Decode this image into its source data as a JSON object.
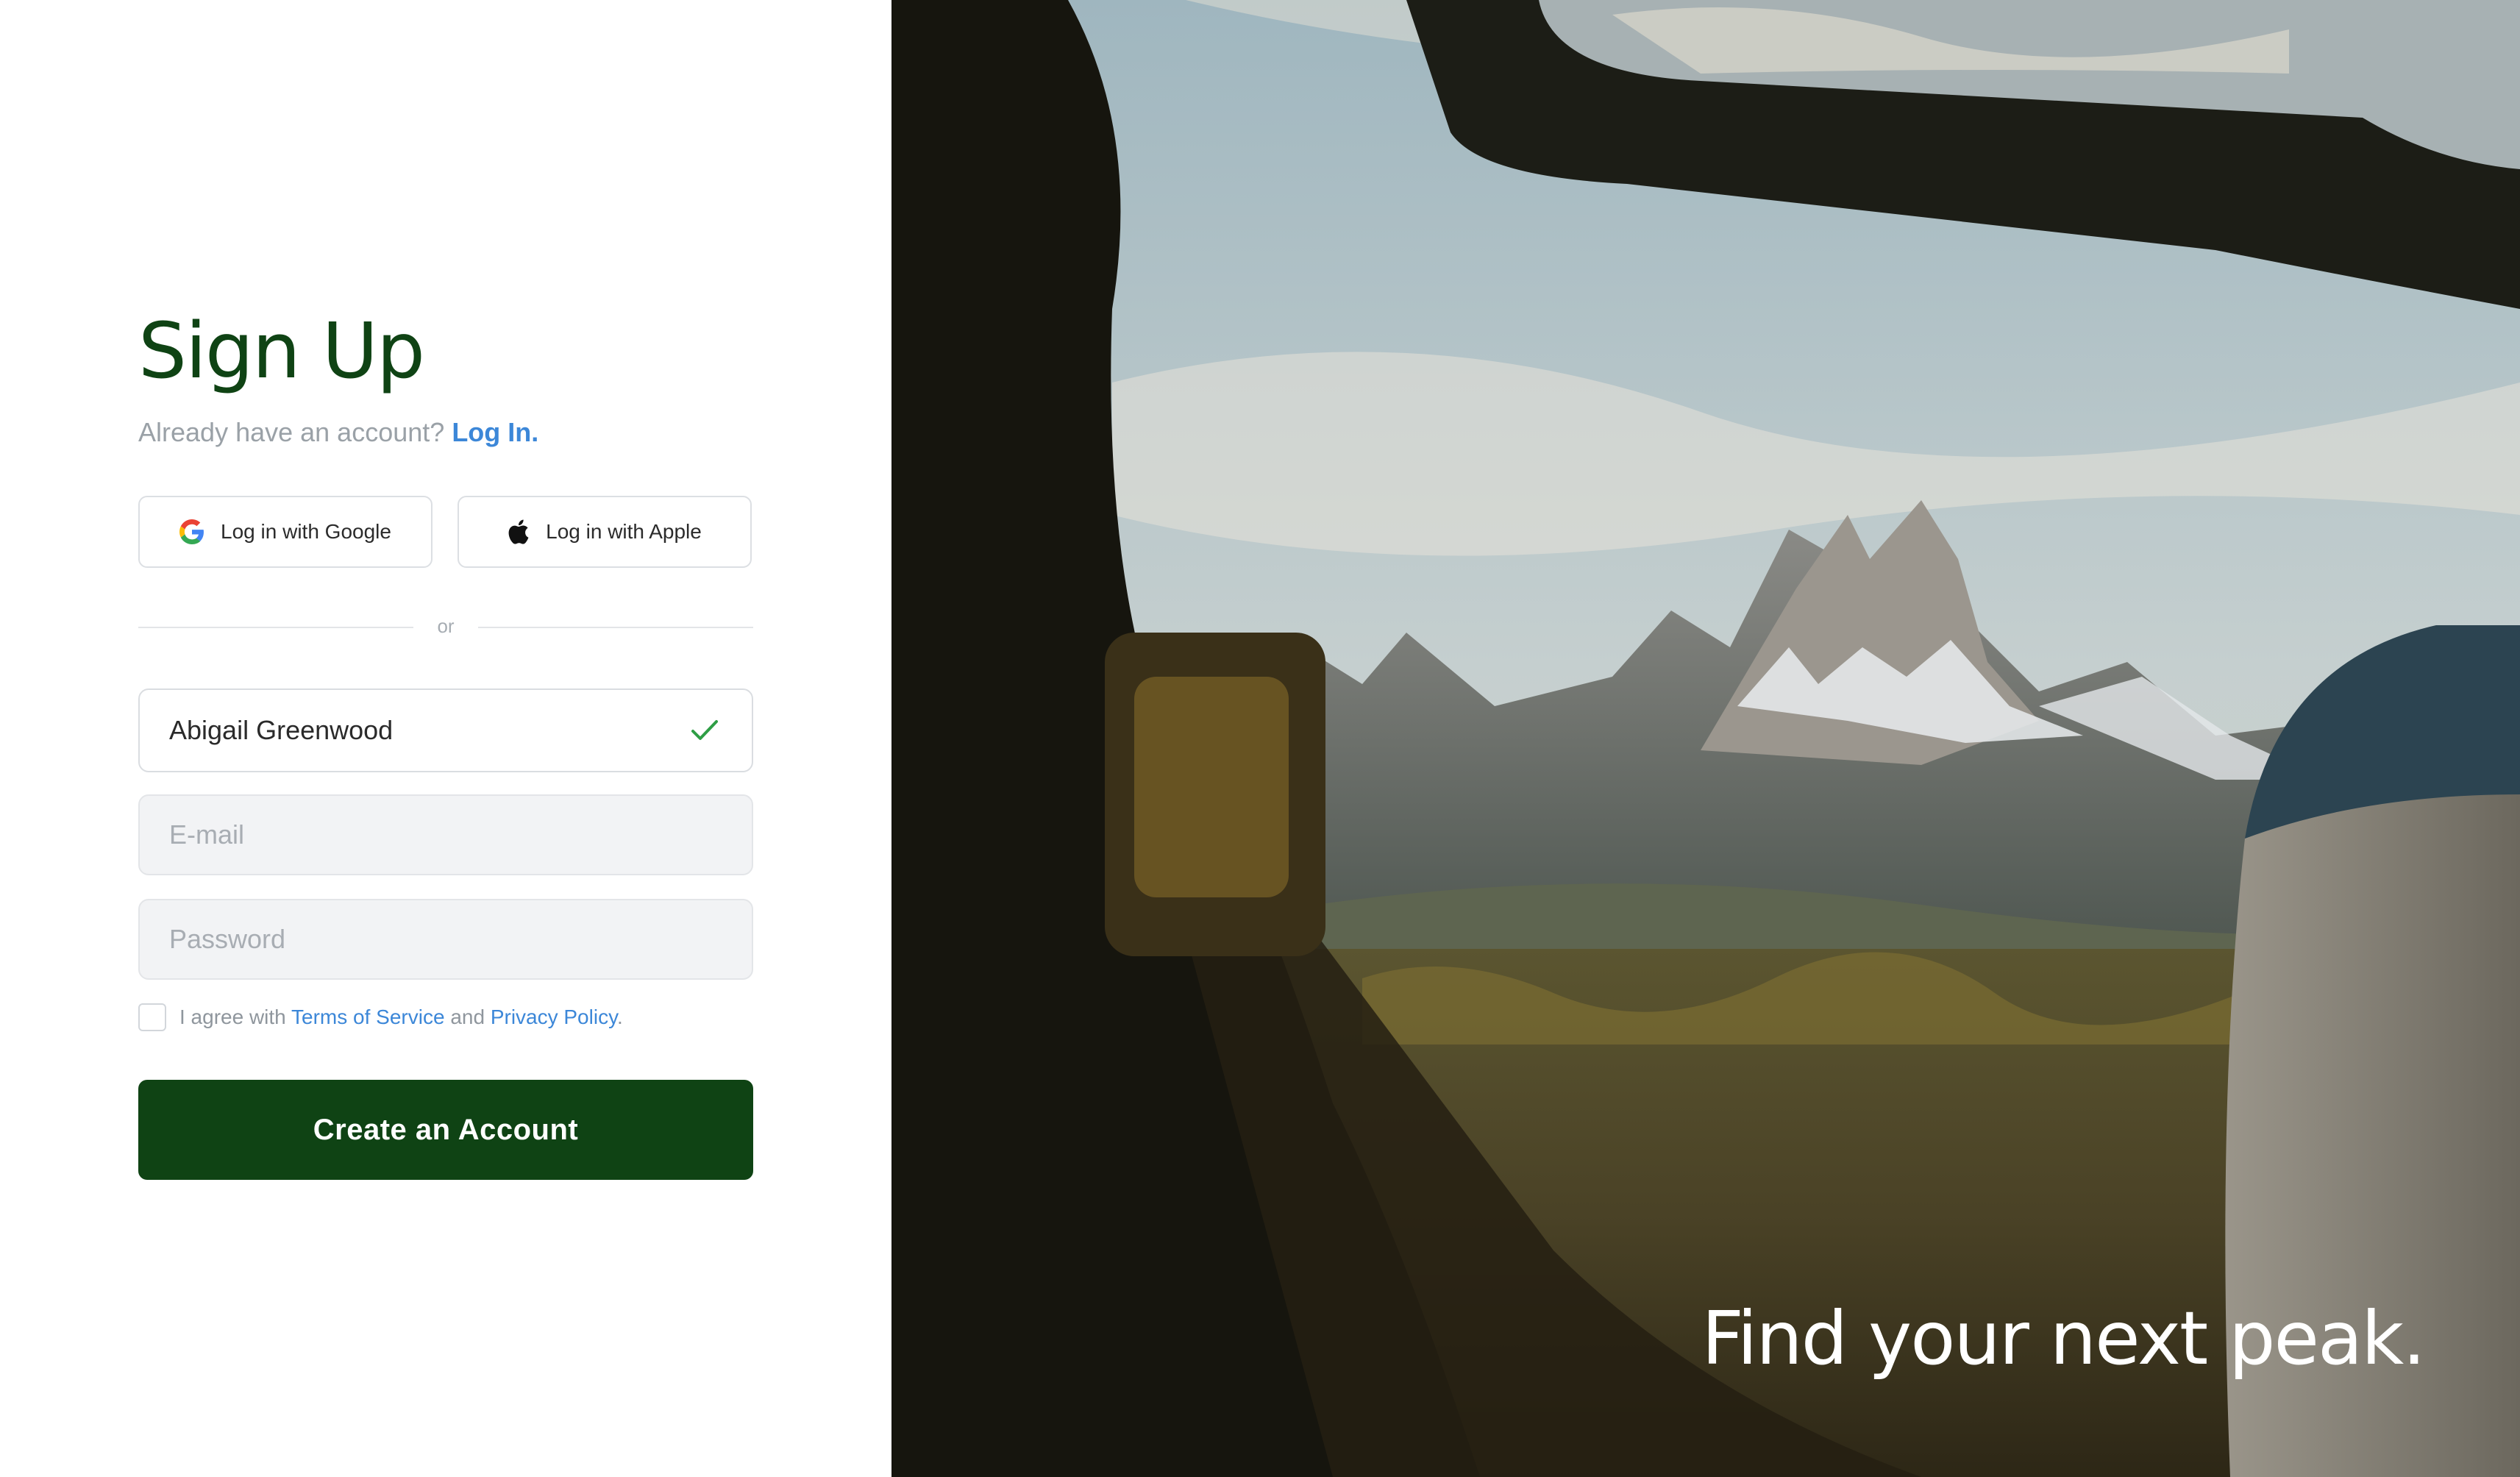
{
  "signup": {
    "title": "Sign Up",
    "have_account": "Already have an account?",
    "login_link": "Log In.",
    "google_button": "Log in with Google",
    "apple_button": "Log in with Apple",
    "divider_text": "or",
    "name_value": "Abigail Greenwood",
    "email_placeholder": "E-mail",
    "password_placeholder": "Password",
    "agree_prefix": "I agree with",
    "terms_link": "Terms of Service",
    "agree_and": "and",
    "privacy_link": "Privacy Policy",
    "agree_suffix": ".",
    "submit_button": "Create an Account"
  },
  "hero": {
    "tagline": "Find your next peak."
  },
  "colors": {
    "brand_green": "#0f4314",
    "link_blue": "#3c87d8",
    "valid_check": "#2e9e45",
    "muted_text": "#9aa1a7"
  },
  "icons": {
    "google": "google-icon",
    "apple": "apple-icon",
    "valid": "checkmark-icon"
  }
}
